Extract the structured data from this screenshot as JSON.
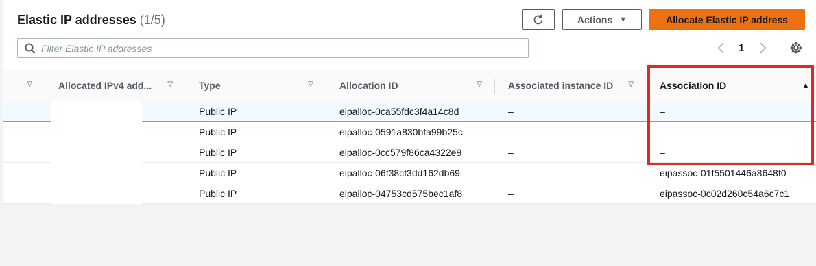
{
  "header": {
    "title": "Elastic IP addresses",
    "count": "(1/5)",
    "refresh_icon": "refresh-icon",
    "actions_label": "Actions",
    "allocate_label": "Allocate Elastic IP address"
  },
  "search": {
    "placeholder": "Filter Elastic IP addresses",
    "value": ""
  },
  "pagination": {
    "current_page": "1"
  },
  "table": {
    "columns": [
      "",
      "Allocated IPv4 add...",
      "Type",
      "Allocation ID",
      "Associated instance ID",
      "Association ID"
    ],
    "sorted_column": "Association ID",
    "sort_direction": "ascending",
    "rows": [
      {
        "ipv4": "",
        "type": "Public IP",
        "allocation_id": "eipalloc-0ca55fdc3f4a14c8d",
        "instance_id": "–",
        "association_id": "–"
      },
      {
        "ipv4": "",
        "type": "Public IP",
        "allocation_id": "eipalloc-0591a830bfa99b25c",
        "instance_id": "–",
        "association_id": "–"
      },
      {
        "ipv4": "",
        "type": "Public IP",
        "allocation_id": "eipalloc-0cc579f86ca4322e9",
        "instance_id": "–",
        "association_id": "–"
      },
      {
        "ipv4": "",
        "type": "Public IP",
        "allocation_id": "eipalloc-06f38cf3dd162db69",
        "instance_id": "–",
        "association_id": "eipassoc-01f5501446a8648f0"
      },
      {
        "ipv4": "",
        "type": "Public IP",
        "allocation_id": "eipalloc-04753cd575bec1af8",
        "instance_id": "–",
        "association_id": "eipassoc-0c02d260c54a6c7c1"
      }
    ]
  },
  "colors": {
    "primary_button": "#ec7211",
    "highlight_box": "#e5281f",
    "selected_row": "#f1faff"
  }
}
